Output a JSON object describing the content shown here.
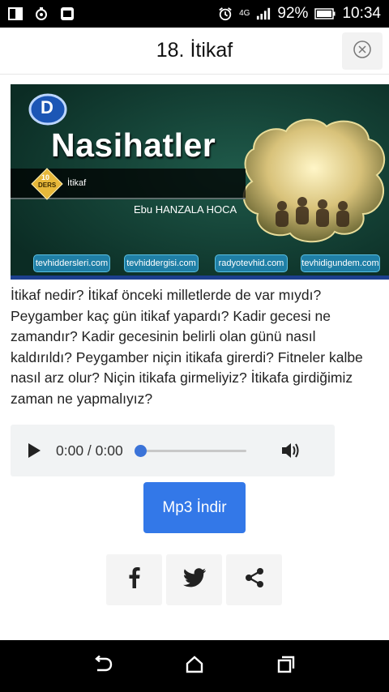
{
  "status_bar": {
    "battery": "92%",
    "time": "10:34",
    "network": "4G"
  },
  "header": {
    "title": "18. İtikaf"
  },
  "banner": {
    "title": "Nasihatler",
    "subtitle": "İtikaf",
    "badge_top": "10",
    "badge_bottom": "DERS",
    "speaker": "Ebu HANZALA HOCA",
    "logo_text": "D",
    "links": [
      "tevhiddersleri.com",
      "tevhiddergisi.com",
      "radyotevhid.com",
      "tevhidigundem.com"
    ]
  },
  "description": "İtikaf nedir? İtikaf önceki milletlerde de var mıydı? Peygamber kaç gün itikaf yapardı? Kadir gecesi ne zamandır? Kadir gecesinin belirli olan günü nasıl kaldırıldı? Peygamber niçin itikafa girerdi? Fitneler kalbe nasıl arz olur? Niçin itikafa girmeliyiz? İtikafa girdiğimiz zaman ne yapmalıyız?",
  "audio": {
    "time": "0:00 / 0:00",
    "progress": 0
  },
  "download_label": "Mp3 İndir",
  "share": {
    "icons": [
      "facebook-icon",
      "twitter-icon",
      "share-icon"
    ]
  },
  "colors": {
    "accent": "#3378e8",
    "banner_bg": "#0f3a30"
  }
}
